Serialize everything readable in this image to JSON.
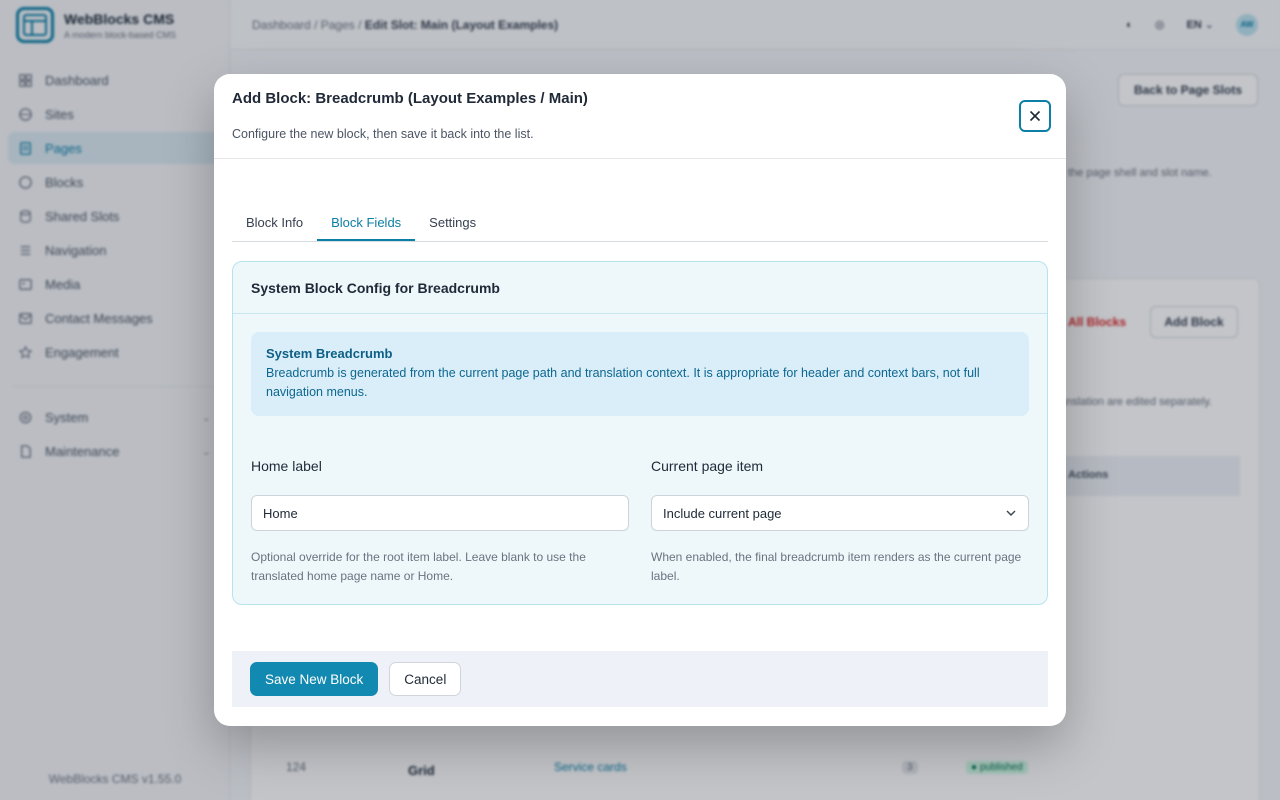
{
  "app": {
    "name": "WebBlocks CMS",
    "tagline": "A modern block-based CMS",
    "version": "WebBlocks CMS v1.55.0"
  },
  "sidebar": {
    "items": [
      {
        "label": "Dashboard",
        "icon": "dashboard-icon"
      },
      {
        "label": "Sites",
        "icon": "globe-icon"
      },
      {
        "label": "Pages",
        "icon": "page-icon"
      },
      {
        "label": "Blocks",
        "icon": "blocks-icon"
      },
      {
        "label": "Shared Slots",
        "icon": "database-icon"
      },
      {
        "label": "Navigation",
        "icon": "menu-icon"
      },
      {
        "label": "Media",
        "icon": "image-icon"
      },
      {
        "label": "Contact Messages",
        "icon": "mail-icon"
      },
      {
        "label": "Engagement",
        "icon": "star-icon"
      }
    ],
    "groups": [
      {
        "label": "System",
        "icon": "gear-icon"
      },
      {
        "label": "Maintenance",
        "icon": "file-icon"
      }
    ]
  },
  "topbar": {
    "breadcrumb": [
      "Dashboard",
      "Pages"
    ],
    "breadcrumb_current": "Edit Slot: Main (Layout Examples)",
    "language": "EN",
    "avatar": "AW"
  },
  "background": {
    "back_button": "Back to Page Slots",
    "hint_text": "the page shell and slot name.",
    "all_blocks": "All Blocks",
    "add_block": "Add Block",
    "translation_note": "anslation are edited separately.",
    "actions_header": "Actions",
    "last_row": {
      "id": "124",
      "type": "Grid",
      "name": "Service cards",
      "count": "3",
      "status": "● published"
    }
  },
  "modal": {
    "title": "Add Block: Breadcrumb (Layout Examples / Main)",
    "subtitle": "Configure the new block, then save it back into the list.",
    "tabs": [
      "Block Info",
      "Block Fields",
      "Settings"
    ],
    "active_tab": 1,
    "panel": {
      "heading": "System Block Config for Breadcrumb",
      "info_title": "System Breadcrumb",
      "info_text": "Breadcrumb is generated from the current page path and translation context. It is appropriate for header and context bars, not full navigation menus."
    },
    "fields": {
      "home_label": {
        "label": "Home label",
        "value": "Home",
        "help": "Optional override for the root item label. Leave blank to use the translated home page name or Home."
      },
      "current_page": {
        "label": "Current page item",
        "value": "Include current page",
        "help": "When enabled, the final breadcrumb item renders as the current page label."
      }
    },
    "footer": {
      "save_label": "Save New Block",
      "cancel_label": "Cancel"
    }
  },
  "colors": {
    "accent": "#0b7fa6",
    "primary_button": "#1289b0",
    "panel_bg": "#eef8fa",
    "info_bg": "#d9eef9"
  }
}
